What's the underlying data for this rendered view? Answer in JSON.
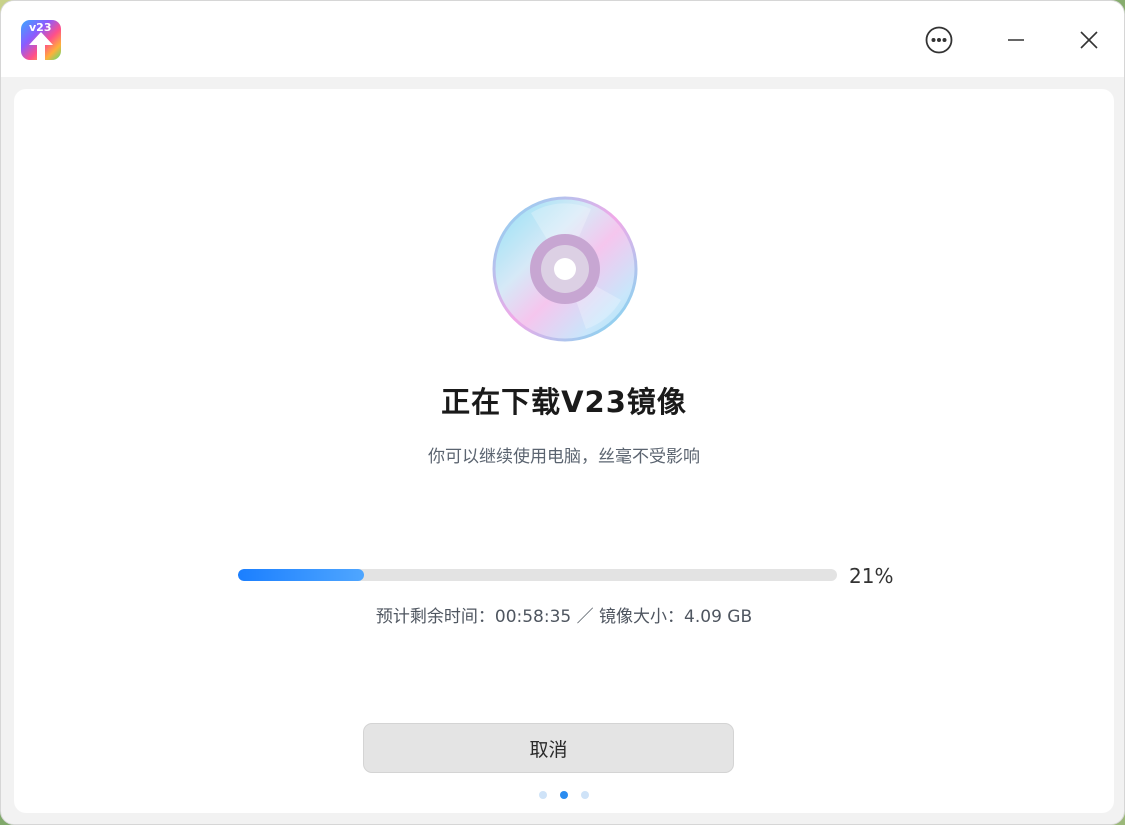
{
  "app": {
    "icon_label": "v23",
    "icon": "upgrade-arrow-icon"
  },
  "titlebar": {
    "more_icon": "more-options-icon",
    "minimize_icon": "minimize-icon",
    "close_icon": "close-icon"
  },
  "main": {
    "illustration": "disc-icon",
    "title": "正在下载V23镜像",
    "subtitle": "你可以继续使用电脑，丝毫不受影响",
    "progress": {
      "value": 0.21,
      "percent_label": "21%"
    },
    "info_text": "预计剩余时间：00:58:35 ／ 镜像大小：4.09 GB",
    "cancel_label": "取消",
    "pagination": {
      "total": 3,
      "current": 2
    }
  },
  "colors": {
    "accent": "#2a8cf0",
    "progress_track": "#e3e3e3"
  }
}
